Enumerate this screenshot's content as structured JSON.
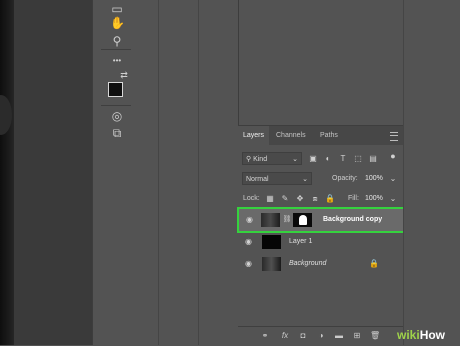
{
  "toolbar": {
    "tools": [
      {
        "icon": "rectangle-icon",
        "glyph": "▭"
      },
      {
        "icon": "smudge-icon",
        "glyph": "✋"
      },
      {
        "icon": "zoom-icon",
        "glyph": "⚲"
      },
      {
        "icon": "more-tools-icon",
        "glyph": "•••"
      },
      {
        "icon": "swap-colors-icon",
        "glyph": "⇄"
      },
      {
        "icon": "quick-mask-icon",
        "glyph": "◎"
      },
      {
        "icon": "screen-mode-icon",
        "glyph": "⧉"
      }
    ],
    "foreground_color": "#0f0f0f",
    "background_color": "#ffffff"
  },
  "layers_panel": {
    "tabs": [
      "Layers",
      "Channels",
      "Paths"
    ],
    "active_tab": "Layers",
    "filter": {
      "value": "Kind",
      "icon": "search-icon"
    },
    "blend_mode": "Normal",
    "opacity_label": "Opacity:",
    "opacity_value": "100%",
    "lock_label": "Lock:",
    "fill_label": "Fill:",
    "fill_value": "100%",
    "layers": [
      {
        "name": "Background copy",
        "selected": true,
        "has_mask": true
      },
      {
        "name": "Layer 1",
        "selected": false,
        "has_mask": false
      },
      {
        "name": "Background",
        "selected": false,
        "has_mask": false,
        "italic": true,
        "locked": true
      }
    ]
  },
  "bottom_icons": [
    "link-icon",
    "fx-icon",
    "mask-icon",
    "adjustment-icon",
    "folder-icon",
    "new-layer-icon",
    "trash-icon"
  ],
  "watermark": {
    "prefix": "wiki",
    "suffix": "How"
  },
  "colors": {
    "selection_outline": "#35d23e",
    "panel_bg": "#535353"
  }
}
